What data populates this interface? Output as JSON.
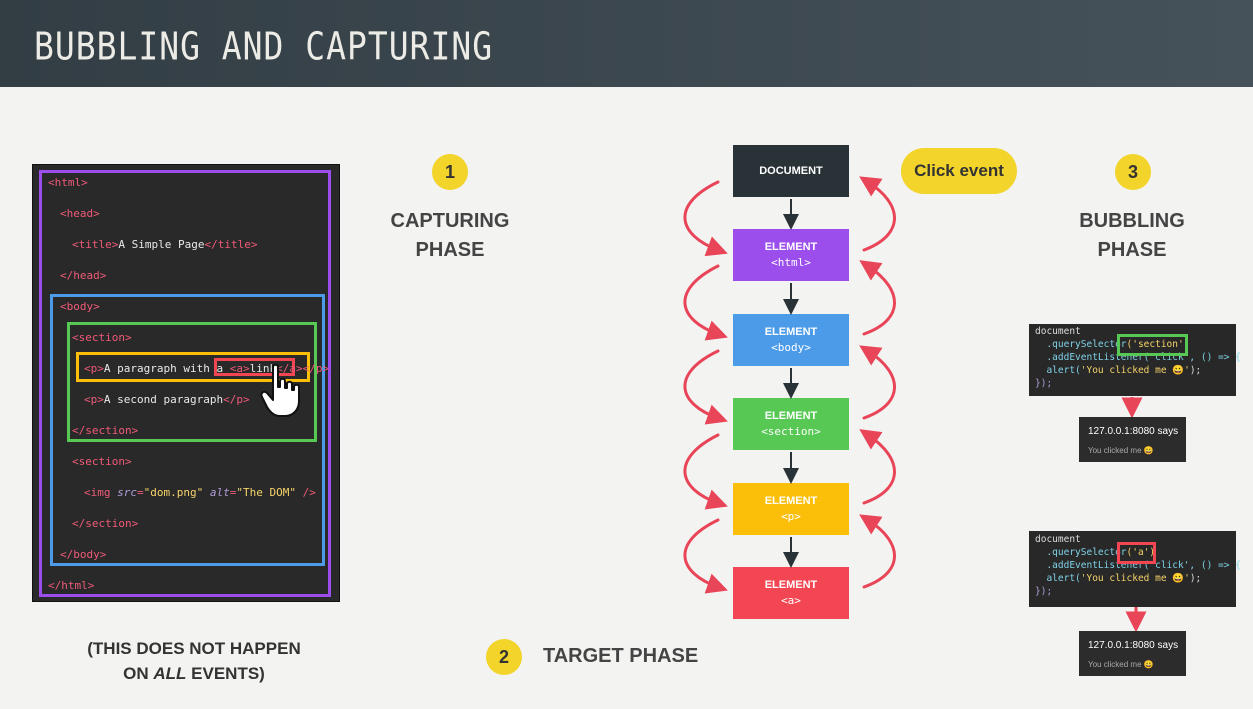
{
  "header": {
    "title": "BUBBLING AND CAPTURING"
  },
  "code": {
    "html_open": "html",
    "head_open": "head",
    "title_tag": "title",
    "title_text": "A Simple Page",
    "head_close": "/head",
    "body_open": "body",
    "section_open": "section",
    "p_tag": "p",
    "p1_text": "A paragraph with a ",
    "a_tag": "a",
    "link_text": "link",
    "p1_tail_close": "/p",
    "p2_text": "A second paragraph",
    "section_close": "/section",
    "img_tag": "img",
    "img_src_attr": "src",
    "img_src_val": "\"dom.png\"",
    "img_alt_attr": "alt",
    "img_alt_val": "\"The DOM\"",
    "img_close": " />",
    "body_close": "/body",
    "html_close": "/html"
  },
  "phases": {
    "capturing": {
      "number": "1",
      "line1": "CAPTURING",
      "line2": "PHASE"
    },
    "target": {
      "number": "2",
      "label": "TARGET PHASE"
    },
    "bubbling": {
      "number": "3",
      "line1": "BUBBLING",
      "line2": "PHASE"
    }
  },
  "click_event_label": "Click event",
  "tree": {
    "nodes": [
      {
        "label": "DOCUMENT",
        "tag": "",
        "color": "#283237"
      },
      {
        "label": "ELEMENT",
        "tag": "<html>",
        "color": "#9b4eec"
      },
      {
        "label": "ELEMENT",
        "tag": "<body>",
        "color": "#4b9be9"
      },
      {
        "label": "ELEMENT",
        "tag": "<section>",
        "color": "#56c853"
      },
      {
        "label": "ELEMENT",
        "tag": "<p>",
        "color": "#fbbf0a"
      },
      {
        "label": "ELEMENT",
        "tag": "<a>",
        "color": "#f24753"
      }
    ]
  },
  "colors": {
    "html_box": "#9b4eec",
    "body_box": "#4b9be9",
    "section_box": "#56c853",
    "p_box": "#fbbf0a",
    "a_box": "#f24753",
    "capture_arrow": "#e94559",
    "accent_yellow": "#f2d42a"
  },
  "snippets": [
    {
      "line1": "document",
      "line2_prefix": "  .querySelector",
      "selector": "('section')",
      "line3": "  .addEventListener('click', () => {",
      "line4_prefix": "  alert(",
      "alert_arg": "'You clicked me 😀'",
      "line4_suffix": ");",
      "line5": "});",
      "highlight_color": "#56c853"
    },
    {
      "line1": "document",
      "line2_prefix": "  .querySelector",
      "selector": "('a')",
      "line3": "  .addEventListener('click', () => {",
      "line4_prefix": "  alert(",
      "alert_arg": "'You clicked me 😀'",
      "line4_suffix": ");",
      "line5": "});",
      "highlight_color": "#f24753"
    }
  ],
  "alerts": [
    {
      "title": "127.0.0.1:8080 says",
      "message": "You clicked me 😀"
    },
    {
      "title": "127.0.0.1:8080 says",
      "message": "You clicked me 😀"
    }
  ],
  "note": {
    "line1": "(THIS DOES NOT HAPPEN",
    "line2_prefix": "ON ",
    "line2_em": "ALL",
    "line2_suffix": " EVENTS)"
  }
}
